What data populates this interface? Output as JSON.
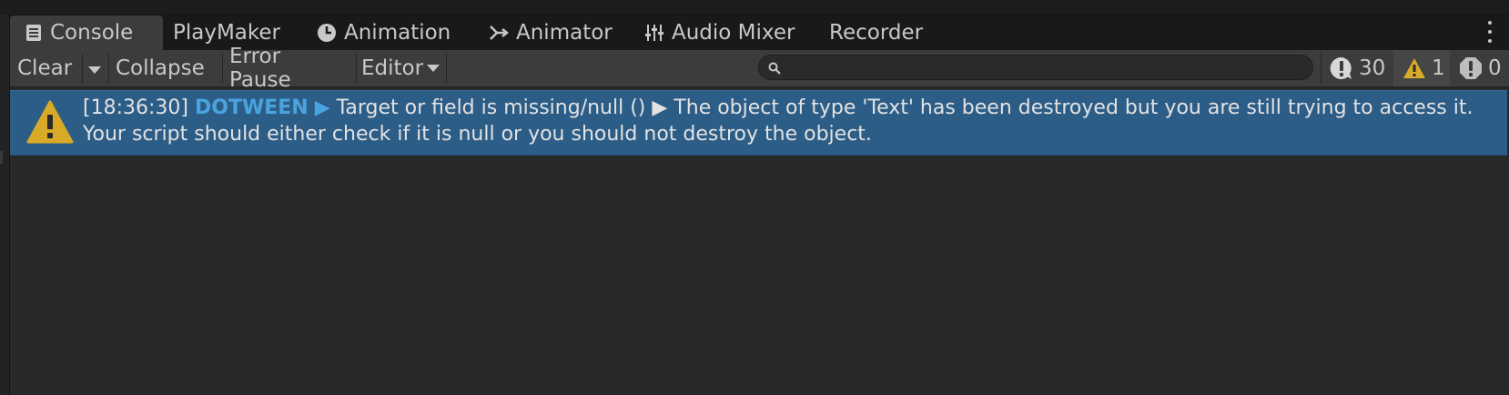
{
  "tabs": [
    {
      "label": "Console",
      "icon": "console-icon",
      "active": true
    },
    {
      "label": "PlayMaker",
      "icon": "",
      "active": false
    },
    {
      "label": "Animation",
      "icon": "clock-icon",
      "active": false
    },
    {
      "label": "Animator",
      "icon": "animator-icon",
      "active": false
    },
    {
      "label": "Audio Mixer",
      "icon": "mixer-sliders-icon",
      "active": false
    },
    {
      "label": "Recorder",
      "icon": "",
      "active": false
    }
  ],
  "toolbar": {
    "clear_label": "Clear",
    "collapse_label": "Collapse",
    "error_pause_label": "Error Pause",
    "editor_label": "Editor",
    "search_value": "",
    "counts": {
      "info": "30",
      "warning": "1",
      "error": "0"
    }
  },
  "log": {
    "timestamp": "[18:36:30]",
    "tag": "DOTWEEN",
    "arrow1": "▶",
    "message_part1": "Target or field is missing/null ()",
    "arrow2": "▶",
    "message_part2": "The object of type 'Text' has been destroyed but you are still trying to access it.",
    "message_line2": "Your script should either check if it is null or you should not destroy the object."
  },
  "colors": {
    "accent_blue": "#4aa3df",
    "selected_row": "#2c5d87",
    "warning_yellow": "#d9a928"
  }
}
